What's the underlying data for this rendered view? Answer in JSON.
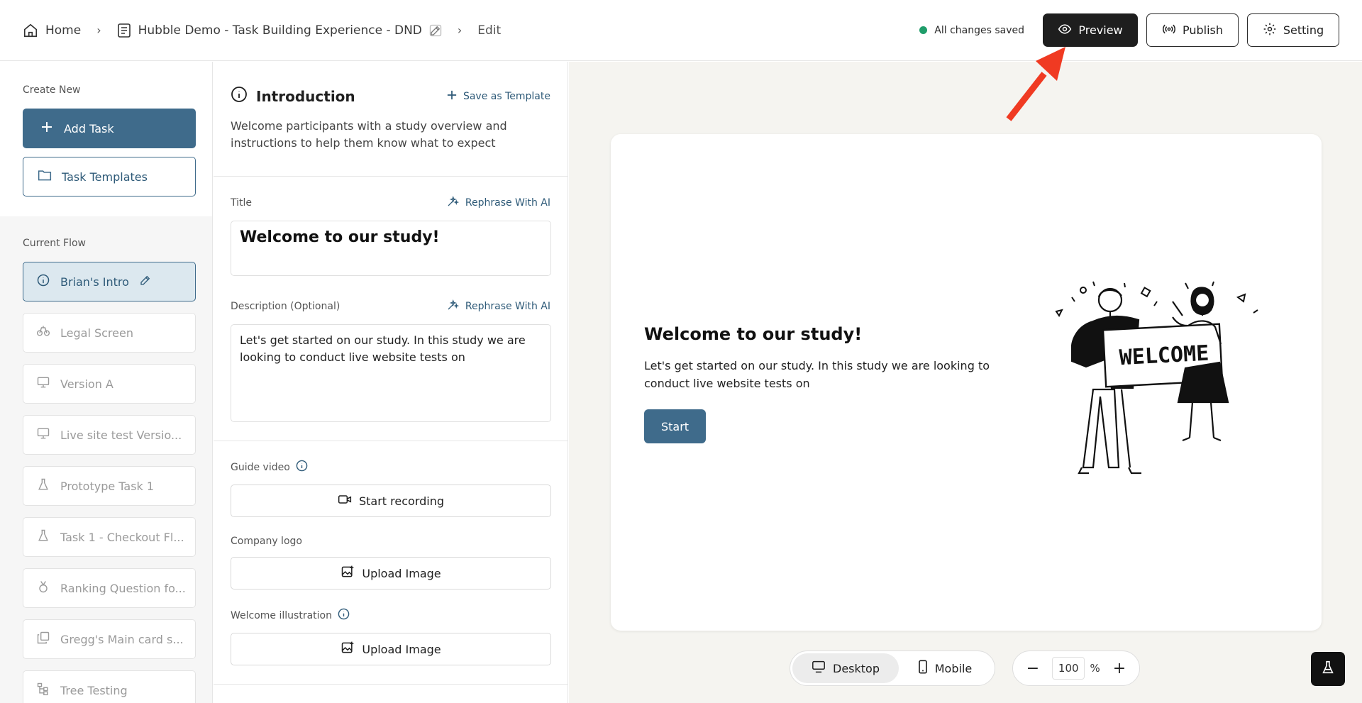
{
  "header": {
    "breadcrumbs": [
      {
        "label": "Home",
        "icon": "home-icon"
      },
      {
        "label": "Hubble Demo - Task Building Experience - DND",
        "icon": "document-icon"
      },
      {
        "label": "Edit"
      }
    ],
    "status": "All changes saved",
    "status_color": "#1f9d6a",
    "preview_label": "Preview",
    "publish_label": "Publish",
    "setting_label": "Setting"
  },
  "sidebar": {
    "create_new_label": "Create New",
    "add_task_label": "Add Task",
    "task_templates_label": "Task Templates",
    "current_flow_label": "Current Flow",
    "flow": [
      {
        "label": "Brian's Intro",
        "icon": "info-icon",
        "active": true
      },
      {
        "label": "Legal Screen",
        "icon": "scale-icon"
      },
      {
        "label": "Version A",
        "icon": "monitor-icon"
      },
      {
        "label": "Live site test Versio...",
        "icon": "monitor-icon"
      },
      {
        "label": "Prototype Task 1",
        "icon": "flask-icon"
      },
      {
        "label": "Task 1 - Checkout Fl...",
        "icon": "flask-icon"
      },
      {
        "label": "Ranking Question fo...",
        "icon": "medal-icon"
      },
      {
        "label": "Gregg's Main card s...",
        "icon": "cards-icon"
      },
      {
        "label": "Tree Testing",
        "icon": "tree-icon"
      }
    ]
  },
  "editor": {
    "section_title": "Introduction",
    "save_template_label": "Save as Template",
    "section_desc": "Welcome participants with a study overview and instructions to help them know what to expect",
    "title_label": "Title",
    "rephrase_label": "Rephrase With AI",
    "title_value": "Welcome to our study!",
    "desc_label": "Description (Optional)",
    "desc_value": "Let's get started on our study. In this study we are looking to conduct live website tests on",
    "guide_video_label": "Guide video",
    "start_recording_label": "Start recording",
    "company_logo_label": "Company logo",
    "upload_image_label": "Upload Image",
    "welcome_illustration_label": "Welcome illustration"
  },
  "preview": {
    "title": "Welcome to our study!",
    "description": "Let's get started on our study. In this study we are looking to conduct live website tests on",
    "start_label": "Start",
    "illustration_text": "WELCOME"
  },
  "viewport": {
    "desktop_label": "Desktop",
    "mobile_label": "Mobile",
    "zoom_value": "100",
    "zoom_unit": "%",
    "minus": "−",
    "plus": "+"
  },
  "colors": {
    "accent": "#3f6b8b",
    "annotation_arrow": "#f03a22"
  }
}
